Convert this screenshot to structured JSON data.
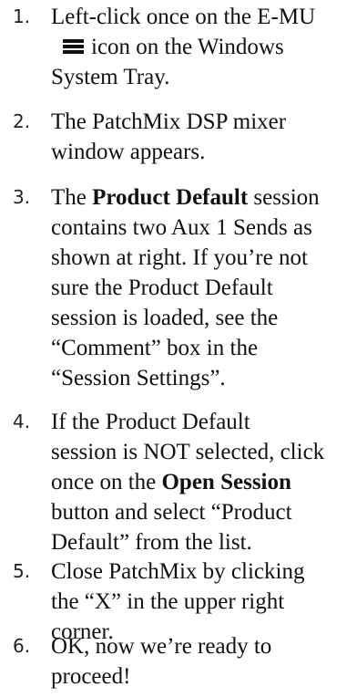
{
  "steps": [
    {
      "number": "1.",
      "lines": [
        "Left-click once on the E-MU",
        "icon on the Windows",
        "System Tray."
      ],
      "icon": "emu-tray-icon"
    },
    {
      "number": "2.",
      "lines": [
        "The PatchMix DSP mixer",
        "window appears."
      ]
    },
    {
      "number": "3.",
      "line1_pre": "The ",
      "line1_bold": "Product Default",
      "line1_post": " session",
      "lines": [
        "contains two Aux 1 Sends as",
        "shown at right. If you’re not",
        "sure the Product Default",
        "session is loaded, see the",
        "“Comment” box in the",
        "“Session Settings”."
      ]
    },
    {
      "number": "4.",
      "lines": [
        "If the Product Default",
        "session is NOT selected, click"
      ],
      "line3_pre": "once on the ",
      "line3_bold": "Open Session",
      "lines_after": [
        "button and select “Product",
        "Default” from the list."
      ]
    },
    {
      "number": "5.",
      "lines": [
        "Close PatchMix by clicking",
        "the “X” in the upper right",
        "corner."
      ]
    },
    {
      "number": "6.",
      "lines": [
        "OK, now we’re ready to",
        "proceed!"
      ]
    }
  ]
}
